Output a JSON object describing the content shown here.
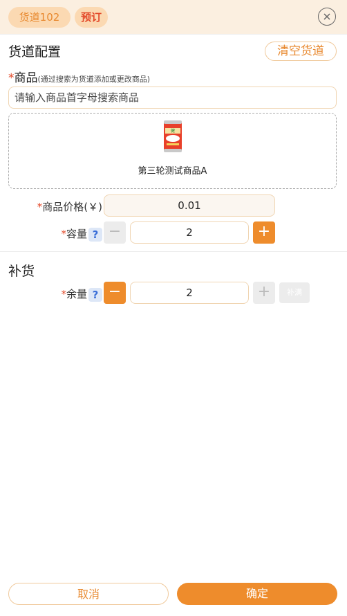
{
  "header": {
    "channel_tag": "货道102",
    "reserve_tag": "预订"
  },
  "config": {
    "title": "货道配置",
    "clear_label": "清空货道",
    "product_label": "商品",
    "product_hint": "(通过搜索为货道添加或更改商品)",
    "search_placeholder": "请输入商品首字母搜索商品",
    "selected_product_name": "第三轮测试商品A",
    "price_label": "商品价格(￥)",
    "price_value": "0.01",
    "capacity_label": "容量",
    "capacity_value": "2"
  },
  "restock": {
    "title": "补货",
    "remaining_label": "余量",
    "remaining_value": "2",
    "fill_label": "补满"
  },
  "icons": {
    "help": "?",
    "minus": "−",
    "plus": "+"
  },
  "footer": {
    "cancel_label": "取消",
    "confirm_label": "确定"
  },
  "colors": {
    "accent": "#ee8c2c",
    "required": "#e34a2a",
    "header_bg": "#fbefe0"
  }
}
